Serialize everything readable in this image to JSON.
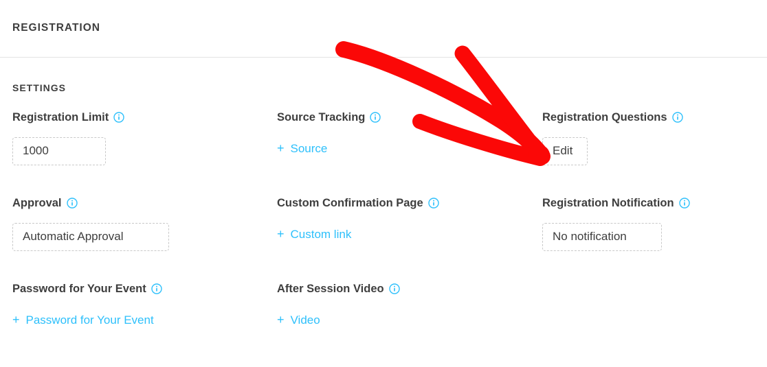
{
  "page": {
    "section_title": "REGISTRATION",
    "subsection_title": "SETTINGS"
  },
  "colors": {
    "accent_blue": "#2ec0fb",
    "text_dark": "#3e3e3e",
    "divider": "#e4e4e4",
    "control_border": "#c8c8c8",
    "annotation_red": "#fb0807"
  },
  "icons": {
    "info": "info-circle-icon",
    "plus": "+"
  },
  "settings": {
    "rows": [
      {
        "cells": [
          {
            "label": "Registration Limit",
            "info_icon": "info-circle-icon",
            "control": {
              "kind": "input",
              "value": "1000",
              "width_class": "w-limit"
            }
          },
          {
            "label": "Source Tracking",
            "info_icon": "info-circle-icon",
            "control": {
              "kind": "add-link",
              "plus": "+",
              "value": "Source"
            }
          },
          {
            "label": "Registration Questions",
            "info_icon": "info-circle-icon",
            "control": {
              "kind": "button",
              "value": "Edit",
              "width_class": "w-edit"
            }
          }
        ]
      },
      {
        "cells": [
          {
            "label": "Approval",
            "info_icon": "info-circle-icon",
            "control": {
              "kind": "select",
              "value": "Automatic Approval",
              "width_class": "w-approval"
            }
          },
          {
            "label": "Custom Confirmation Page",
            "info_icon": "info-circle-icon",
            "control": {
              "kind": "add-link",
              "plus": "+",
              "value": "Custom link"
            }
          },
          {
            "label": "Registration Notification",
            "info_icon": "info-circle-icon",
            "control": {
              "kind": "select",
              "value": "No notification",
              "width_class": "w-notify"
            }
          }
        ]
      },
      {
        "cells": [
          {
            "label": "Password for Your Event",
            "info_icon": "info-circle-icon",
            "control": {
              "kind": "add-link",
              "plus": "+",
              "value": "Password for Your Event"
            }
          },
          {
            "label": "After Session Video",
            "info_icon": "info-circle-icon",
            "control": {
              "kind": "add-link",
              "plus": "+",
              "value": "Video"
            }
          },
          null
        ]
      }
    ]
  },
  "annotation": {
    "kind": "hand-drawn-arrow",
    "color": "#fb0807",
    "points_to": "Edit"
  }
}
